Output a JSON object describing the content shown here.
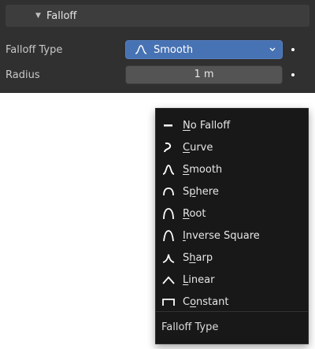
{
  "panel": {
    "header_title": "Falloff",
    "falloff_type": {
      "label": "Falloff Type",
      "value": "Smooth",
      "value_icon": "smooth-curve-icon"
    },
    "radius": {
      "label": "Radius",
      "value": "1 m"
    },
    "accent_color": "#4772b3"
  },
  "menu": {
    "items": [
      {
        "pre": "",
        "ul": "N",
        "post": "o Falloff",
        "icon": "no-falloff-icon"
      },
      {
        "pre": "",
        "ul": "C",
        "post": "urve",
        "icon": "curve-falloff-icon"
      },
      {
        "pre": "",
        "ul": "S",
        "post": "mooth",
        "icon": "smooth-falloff-icon"
      },
      {
        "pre": "S",
        "ul": "p",
        "post": "here",
        "icon": "sphere-falloff-icon"
      },
      {
        "pre": "",
        "ul": "R",
        "post": "oot",
        "icon": "root-falloff-icon"
      },
      {
        "pre": "",
        "ul": "I",
        "post": "nverse Square",
        "icon": "inverse-square-falloff-icon"
      },
      {
        "pre": "S",
        "ul": "h",
        "post": "arp",
        "icon": "sharp-falloff-icon"
      },
      {
        "pre": "",
        "ul": "L",
        "post": "inear",
        "icon": "linear-falloff-icon"
      },
      {
        "pre": "C",
        "ul": "o",
        "post": "nstant",
        "icon": "constant-falloff-icon"
      }
    ],
    "footer_title": "Falloff Type"
  }
}
